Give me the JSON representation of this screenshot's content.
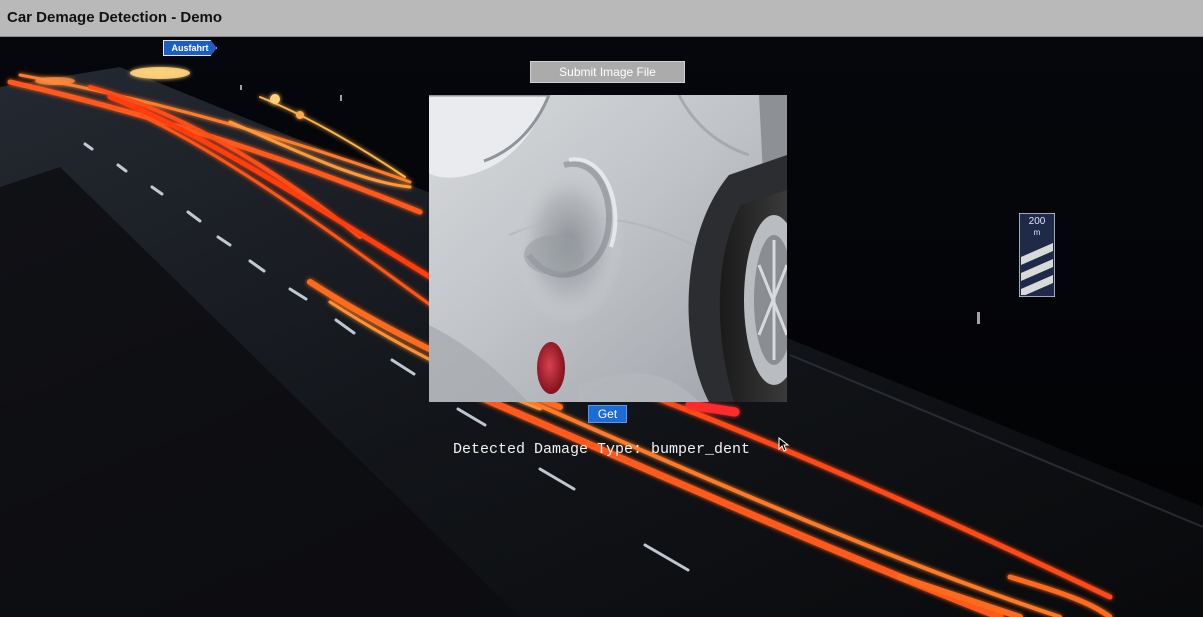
{
  "header": {
    "title": "Car Demage Detection - Demo"
  },
  "background": {
    "exit_sign_label": "Ausfahrt",
    "km_sign_number": "200",
    "km_sign_unit": "m"
  },
  "controls": {
    "submit_label": "Submit Image File",
    "get_label": "Get"
  },
  "result": {
    "prefix": "Detected Damage Type: ",
    "value": "bumper_dent"
  },
  "colors": {
    "header_bg": "#b9b9b9",
    "submit_bg": "#ababab",
    "get_bg": "#1e6bd6",
    "page_bg": "#000000"
  }
}
